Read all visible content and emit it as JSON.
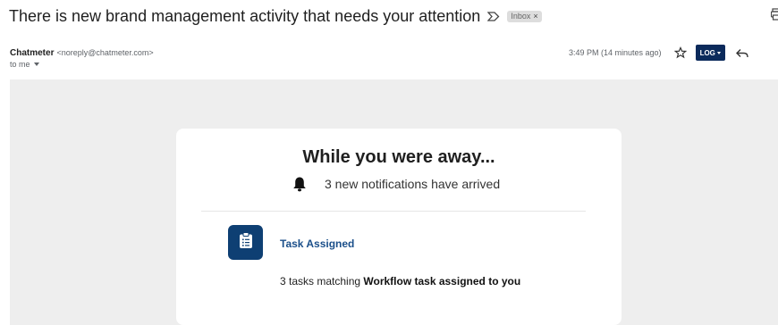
{
  "email": {
    "subject": "There is new brand management activity that needs your attention",
    "label": "Inbox",
    "label_remove": "×",
    "sender_name": "Chatmeter",
    "sender_email": "<noreply@chatmeter.com>",
    "recipient": "to me",
    "timestamp": "3:49 PM (14 minutes ago)"
  },
  "toolbar": {
    "log_label": "LOG"
  },
  "body": {
    "title": "While you were away...",
    "notification_text": "3 new notifications have arrived",
    "task_title": "Task Assigned",
    "task_desc_prefix": "3 tasks matching ",
    "task_desc_bold": "Workflow task assigned to you"
  },
  "colors": {
    "log_button_bg": "#0b2a5b",
    "task_icon_bg": "#0e3f73",
    "task_title_color": "#1b4f8a",
    "body_background": "#eeeeee"
  },
  "icons": [
    "important-marker-icon",
    "print-icon",
    "star-icon",
    "reply-icon",
    "bell-icon",
    "clipboard-icon",
    "chevron-down-icon"
  ]
}
